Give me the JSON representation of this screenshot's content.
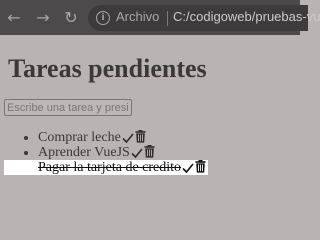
{
  "browser": {
    "back_icon": "arrow-left-icon",
    "forward_icon": "arrow-right-icon",
    "reload_icon": "reload-icon",
    "info_icon": "info-icon",
    "url_label": "Archivo",
    "url": "C:/codigoweb/pruebas-vu"
  },
  "page": {
    "title": "Tareas pendientes",
    "input_placeholder": "Escribe una tarea y presi",
    "tasks": [
      {
        "text": "Comprar leche",
        "done": false
      },
      {
        "text": "Aprender VueJS",
        "done": false
      },
      {
        "text": "Pagar la tarjeta de credito",
        "done": true
      }
    ],
    "check_icon": "check-icon",
    "delete_icon": "trash-icon"
  }
}
